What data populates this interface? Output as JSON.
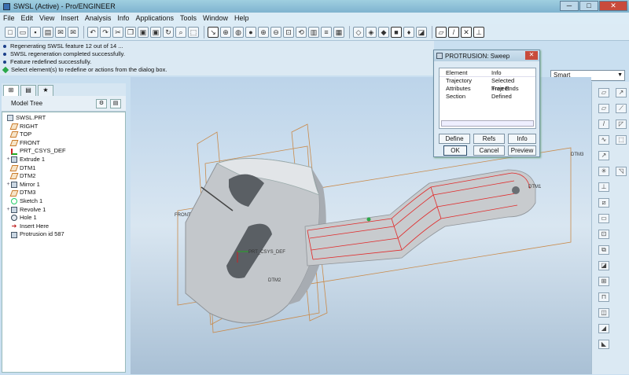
{
  "window": {
    "title": "SWSL (Active) - Pro/ENGINEER",
    "btn_min": "─",
    "btn_max": "□",
    "btn_close": "✕"
  },
  "menu": [
    "File",
    "Edit",
    "View",
    "Insert",
    "Analysis",
    "Info",
    "Applications",
    "Tools",
    "Window",
    "Help"
  ],
  "messages": [
    "Regenerating SWSL feature 12 out of 14 ...",
    "SWSL regeneration completed successfully.",
    "Feature redefined successfully.",
    "Select element(s) to redefine or actions from the dialog box."
  ],
  "filter": {
    "value": "Smart"
  },
  "model_tree": {
    "title": "Model Tree",
    "items": [
      {
        "label": "SWSL.PRT",
        "icon": "part-icon",
        "expand": ""
      },
      {
        "label": "RIGHT",
        "icon": "datum-plane-icon",
        "expand": ""
      },
      {
        "label": "TOP",
        "icon": "datum-plane-icon",
        "expand": ""
      },
      {
        "label": "FRONT",
        "icon": "datum-plane-icon",
        "expand": ""
      },
      {
        "label": "PRT_CSYS_DEF",
        "icon": "csys-icon",
        "expand": ""
      },
      {
        "label": "Extrude 1",
        "icon": "extrude-icon",
        "expand": "+"
      },
      {
        "label": "DTM1",
        "icon": "datum-plane-icon",
        "expand": ""
      },
      {
        "label": "DTM2",
        "icon": "datum-plane-icon",
        "expand": ""
      },
      {
        "label": "Mirror 1",
        "icon": "mirror-icon",
        "expand": "+"
      },
      {
        "label": "DTM3",
        "icon": "datum-plane-icon",
        "expand": ""
      },
      {
        "label": "Sketch 1",
        "icon": "sketch-icon",
        "expand": ""
      },
      {
        "label": "Revolve 1",
        "icon": "revolve-icon",
        "expand": "+"
      },
      {
        "label": "Hole 1",
        "icon": "hole-icon",
        "expand": ""
      },
      {
        "label": "Insert Here",
        "icon": "insert-here-icon",
        "expand": ""
      },
      {
        "label": "Protrusion id 587",
        "icon": "protrusion-icon",
        "expand": ""
      }
    ]
  },
  "viewport_labels": {
    "front": "FRONT",
    "dtm3": "DTM3",
    "dtm1": "DTM1",
    "dtm2": "DTM2",
    "csys": "PRT_CSYS_DEF"
  },
  "dialog": {
    "title": "PROTRUSION: Sweep",
    "col_element": "Element",
    "col_info": "Info",
    "rows": [
      {
        "element": "Trajectory",
        "info": "Selected Traject"
      },
      {
        "element": "Attributes",
        "info": "Free Ends"
      },
      {
        "element": "Section",
        "info": "Defined"
      }
    ],
    "btn_define": "Define",
    "btn_refs": "Refs",
    "btn_info": "Info",
    "btn_ok": "OK",
    "btn_cancel": "Cancel",
    "btn_preview": "Preview"
  }
}
